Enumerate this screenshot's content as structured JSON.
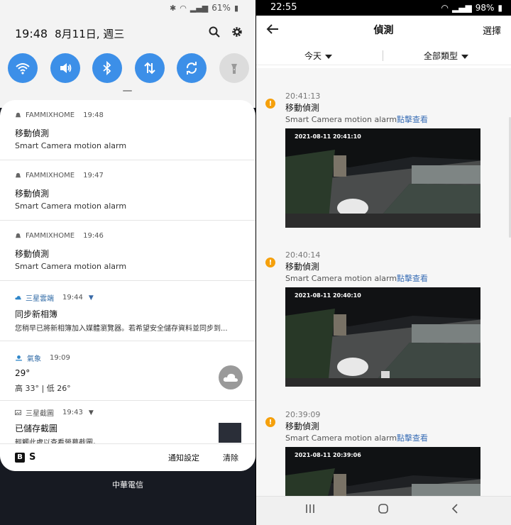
{
  "left": {
    "status": {
      "battery": "61%"
    },
    "clock": {
      "time": "19:48",
      "date": "8月11日, 週三"
    },
    "notifications": [
      {
        "app": "FAMMIXHOME",
        "time": "19:48",
        "title": "移動偵測",
        "body": "Smart  Camera motion alarm"
      },
      {
        "app": "FAMMIXHOME",
        "time": "19:47",
        "title": "移動偵測",
        "body": "Smart  Camera motion alarm"
      },
      {
        "app": "FAMMIXHOME",
        "time": "19:46",
        "title": "移動偵測",
        "body": "Smart  Camera motion alarm"
      },
      {
        "app": "三星雲端",
        "time": "19:44",
        "title": "同步新相簿",
        "body": "您稍早已將新相簿加入媒體瀏覽器。若希望安全儲存資料並同步到..."
      },
      {
        "app": "氣象",
        "time": "19:09",
        "title": "29°",
        "body": "高 33° | 低 26°"
      },
      {
        "app": "三星截圖",
        "time": "19:43",
        "title": "已儲存截圖",
        "body": "輕觸此處以查看螢幕截圖。"
      }
    ],
    "footer": {
      "settings": "通知設定",
      "clear": "清除"
    },
    "carrier": "中華電信"
  },
  "right": {
    "status": {
      "time": "22:55",
      "battery": "98%"
    },
    "appbar": {
      "title": "偵測",
      "select": "選擇"
    },
    "filters": {
      "day": "今天",
      "type": "全部類型"
    },
    "events": [
      {
        "time": "20:41:13",
        "title": "移動偵測",
        "body": "Smart  Camera motion alarm",
        "link": "點擊查看",
        "stamp": "2021-08-11 20:41:10"
      },
      {
        "time": "20:40:14",
        "title": "移動偵測",
        "body": "Smart  Camera motion alarm",
        "link": "點擊查看",
        "stamp": "2021-08-11 20:40:10"
      },
      {
        "time": "20:39:09",
        "title": "移動偵測",
        "body": "Smart  Camera motion alarm",
        "link": "點擊查看",
        "stamp": "2021-08-11 20:39:06"
      }
    ]
  },
  "colors": {
    "accent": "#3c8fe8",
    "alert": "#f5a00c",
    "link": "#3b6fb6"
  },
  "icons": [
    "wifi-icon",
    "volume-icon",
    "bluetooth-icon",
    "data-icon",
    "rotate-icon",
    "flashlight-icon",
    "search-icon",
    "gear-icon",
    "bell-icon",
    "cloud-icon",
    "weather-icon",
    "screenshot-icon",
    "back-arrow-icon",
    "alert-icon",
    "recents-icon",
    "home-icon",
    "back-icon"
  ]
}
